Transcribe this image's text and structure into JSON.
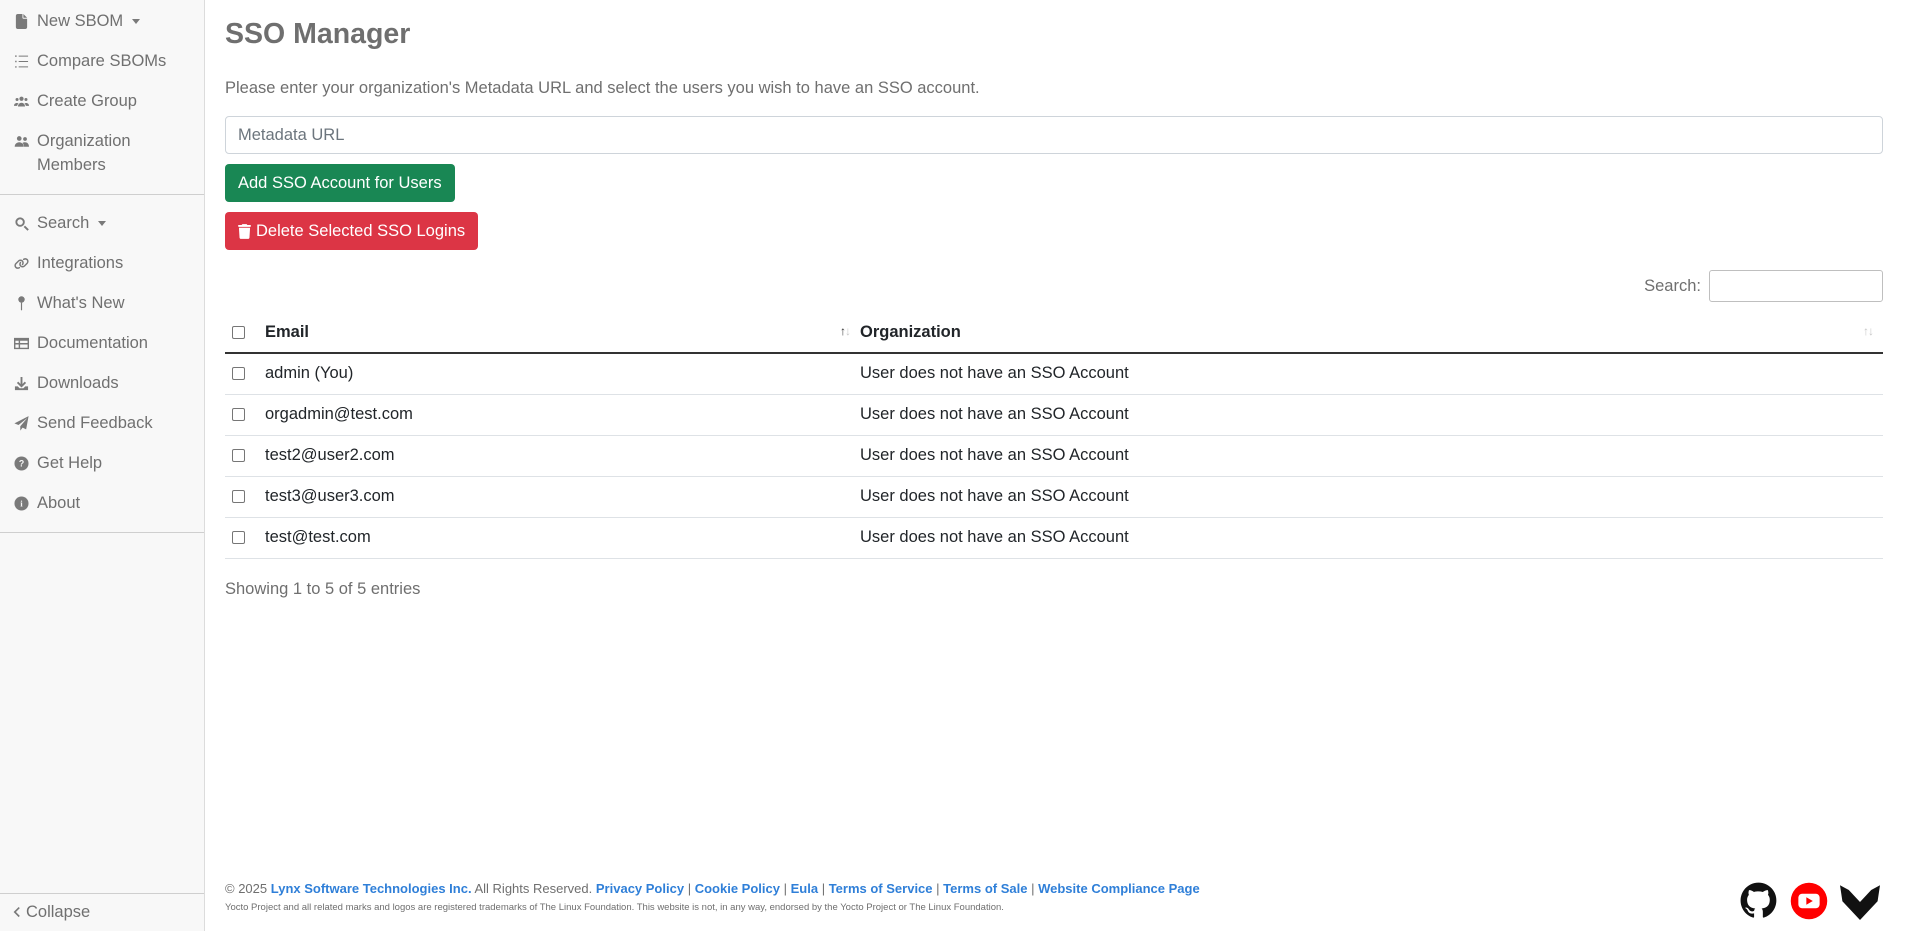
{
  "sidebar": {
    "items": [
      {
        "label": "New SBOM",
        "icon": "file-icon"
      },
      {
        "label": "Compare SBOMs",
        "icon": "list-check-icon"
      },
      {
        "label": "Create Group",
        "icon": "users-icon"
      },
      {
        "label": "Organization",
        "label2": "Members",
        "icon": "user-group-icon"
      },
      {
        "label": "Search",
        "icon": "search-icon"
      },
      {
        "label": "Integrations",
        "icon": "link-icon"
      },
      {
        "label": "What's New",
        "icon": "pin-icon"
      },
      {
        "label": "Documentation",
        "icon": "table-icon"
      },
      {
        "label": "Downloads",
        "icon": "download-icon"
      },
      {
        "label": "Send Feedback",
        "icon": "paper-plane-icon"
      },
      {
        "label": "Get Help",
        "icon": "question-circle-icon"
      },
      {
        "label": "About",
        "icon": "info-circle-icon"
      }
    ],
    "collapse_label": "Collapse"
  },
  "main": {
    "title": "SSO Manager",
    "intro": "Please enter your organization's Metadata URL and select the users you wish to have an SSO account.",
    "metadata_placeholder": "Metadata URL",
    "add_button": "Add SSO Account for Users",
    "delete_button": "Delete Selected SSO Logins",
    "search_label": "Search:",
    "table": {
      "columns": [
        "Email",
        "Organization"
      ],
      "rows": [
        {
          "email": "admin (You)",
          "organization": "User does not have an SSO Account"
        },
        {
          "email": "orgadmin@test.com",
          "organization": "User does not have an SSO Account"
        },
        {
          "email": "test2@user2.com",
          "organization": "User does not have an SSO Account"
        },
        {
          "email": "test3@user3.com",
          "organization": "User does not have an SSO Account"
        },
        {
          "email": "test@test.com",
          "organization": "User does not have an SSO Account"
        }
      ]
    },
    "info": "Showing 1 to 5 of 5 entries"
  },
  "footer": {
    "copyright_prefix": "© 2025",
    "company": "Lynx Software Technologies Inc.",
    "rights": "All Rights Reserved.",
    "links": [
      "Privacy Policy",
      "Cookie Policy",
      "Eula",
      "Terms of Service",
      "Terms of Sale",
      "Website Compliance Page"
    ],
    "trademark": "Yocto Project and all related marks and logos are registered trademarks of The Linux Foundation. This website is not, in any way, endorsed by the Yocto Project or The Linux Foundation."
  },
  "social": [
    "github-icon",
    "youtube-icon",
    "lynx-logo-icon"
  ],
  "colors": {
    "success": "#198754",
    "danger": "#dc3545",
    "link": "#2f7fd8",
    "youtube": "#ff0000"
  }
}
